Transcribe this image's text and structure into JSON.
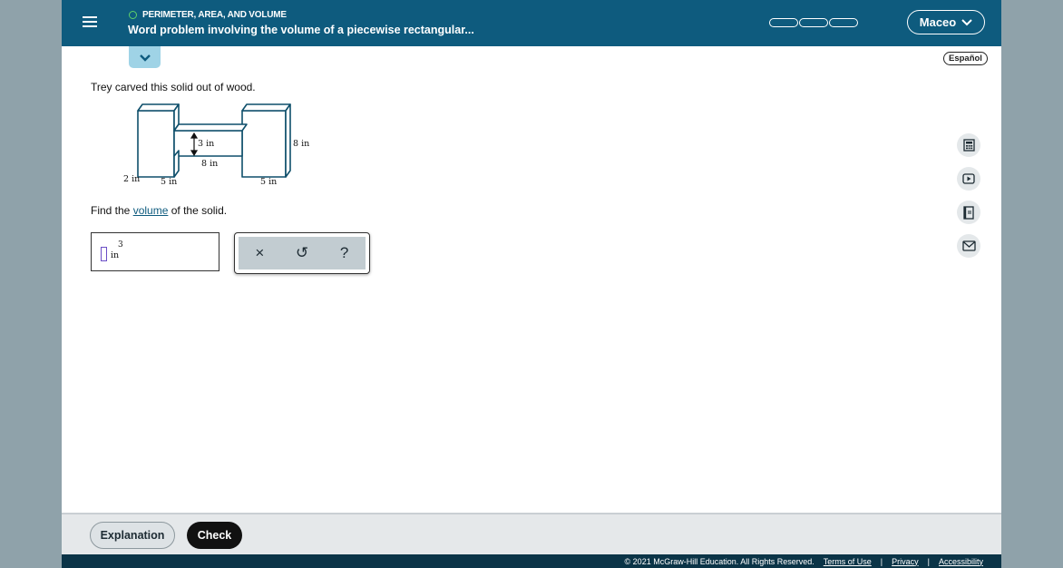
{
  "header": {
    "topic": "PERIMETER, AREA, AND VOLUME",
    "title": "Word problem involving the volume of a piecewise rectangular...",
    "user_name": "Maceo",
    "colors": {
      "header_bg": "#0e5b7e",
      "accent_green": "#5fd16a"
    }
  },
  "language_button": "Español",
  "problem": {
    "statement": "Trey carved this solid out of wood.",
    "find_prefix": "Find the ",
    "find_link": "volume",
    "find_suffix": " of the solid."
  },
  "diagram": {
    "labels": {
      "inner_height": "3 in",
      "right_height": "8 in",
      "bridge_length": "8 in",
      "depth": "2 in",
      "left_width": "5 in",
      "right_width": "5 in"
    }
  },
  "answer": {
    "value": "",
    "unit": "in",
    "exponent": "3"
  },
  "tools": {
    "clear": "×",
    "undo": "↺",
    "help": "?"
  },
  "side_tools": [
    "calculator-icon",
    "video-icon",
    "dictionary-icon",
    "mail-icon"
  ],
  "footer": {
    "explanation_label": "Explanation",
    "check_label": "Check",
    "copyright": "© 2021 McGraw-Hill Education. All Rights Reserved.",
    "terms": "Terms of Use",
    "privacy": "Privacy",
    "accessibility": "Accessibility"
  }
}
